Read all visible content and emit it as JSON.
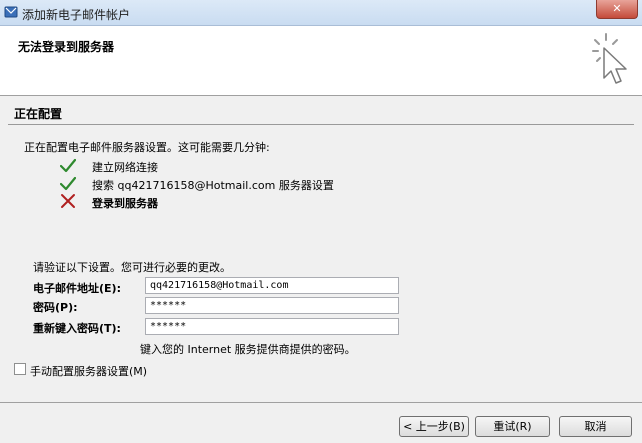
{
  "window": {
    "title": "添加新电子邮件帐户",
    "close_label": "✕"
  },
  "header": {
    "heading": "无法登录到服务器"
  },
  "section": {
    "title": "正在配置",
    "intro": "正在配置电子邮件服务器设置。这可能需要几分钟:"
  },
  "steps": [
    {
      "status": "success",
      "label": "建立网络连接",
      "icon": "check-icon"
    },
    {
      "status": "success",
      "label": "搜索 qq421716158@Hotmail.com 服务器设置",
      "icon": "check-icon"
    },
    {
      "status": "failed",
      "label": "登录到服务器",
      "icon": "cross-icon"
    }
  ],
  "form": {
    "verify_text": "请验证以下设置。您可进行必要的更改。",
    "email_label": "电子邮件地址(E):",
    "email_value": "qq421716158@Hotmail.com",
    "password_label": "密码(P):",
    "password_value": "******",
    "password_confirm_label": "重新键入密码(T):",
    "password_confirm_value": "******",
    "hint": "键入您的 Internet 服务提供商提供的密码。",
    "manual_config_label": "手动配置服务器设置(M)",
    "manual_config_checked": false
  },
  "buttons": {
    "back": "< 上一步(B)",
    "retry": "重试(R)",
    "cancel": "取消"
  },
  "colors": {
    "success": "#2f8a2f",
    "failure": "#b02020"
  }
}
